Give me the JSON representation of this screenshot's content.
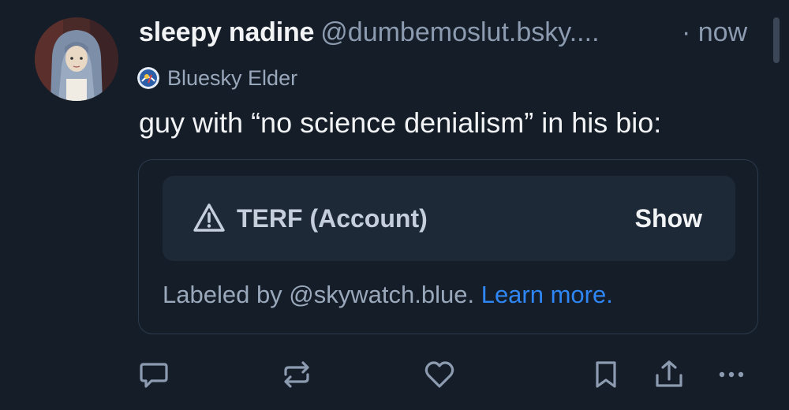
{
  "post": {
    "author": {
      "display_name": "sleepy nadine",
      "handle": "@dumbemoslut.bsky....",
      "avatar_icon": "avatar-image"
    },
    "timestamp": "· now",
    "badge": {
      "label": "Bluesky Elder",
      "icon": "bluesky-elder-badge-icon"
    },
    "text": "guy with “no science denialism” in his bio:",
    "embed": {
      "moderation_label": "TERF (Account)",
      "warning_icon": "warning-triangle-icon",
      "show_label": "Show",
      "labeled_by": "Labeled by @skywatch.blue. ",
      "learn_more": "Learn more."
    }
  },
  "actions": [
    {
      "name": "reply",
      "icon": "comment-icon"
    },
    {
      "name": "repost",
      "icon": "repost-icon"
    },
    {
      "name": "like",
      "icon": "heart-icon"
    },
    {
      "name": "bookmark",
      "icon": "bookmark-icon"
    },
    {
      "name": "share",
      "icon": "share-icon"
    },
    {
      "name": "more",
      "icon": "more-options-icon"
    }
  ],
  "colors": {
    "background": "#151d28",
    "primary_text": "#f1f3f5",
    "secondary_text": "#8c9bb0",
    "link": "#2f86f5",
    "card_border": "#2c3a4c",
    "label_bar": "#1e2938",
    "icon": "#8c9bb0"
  }
}
